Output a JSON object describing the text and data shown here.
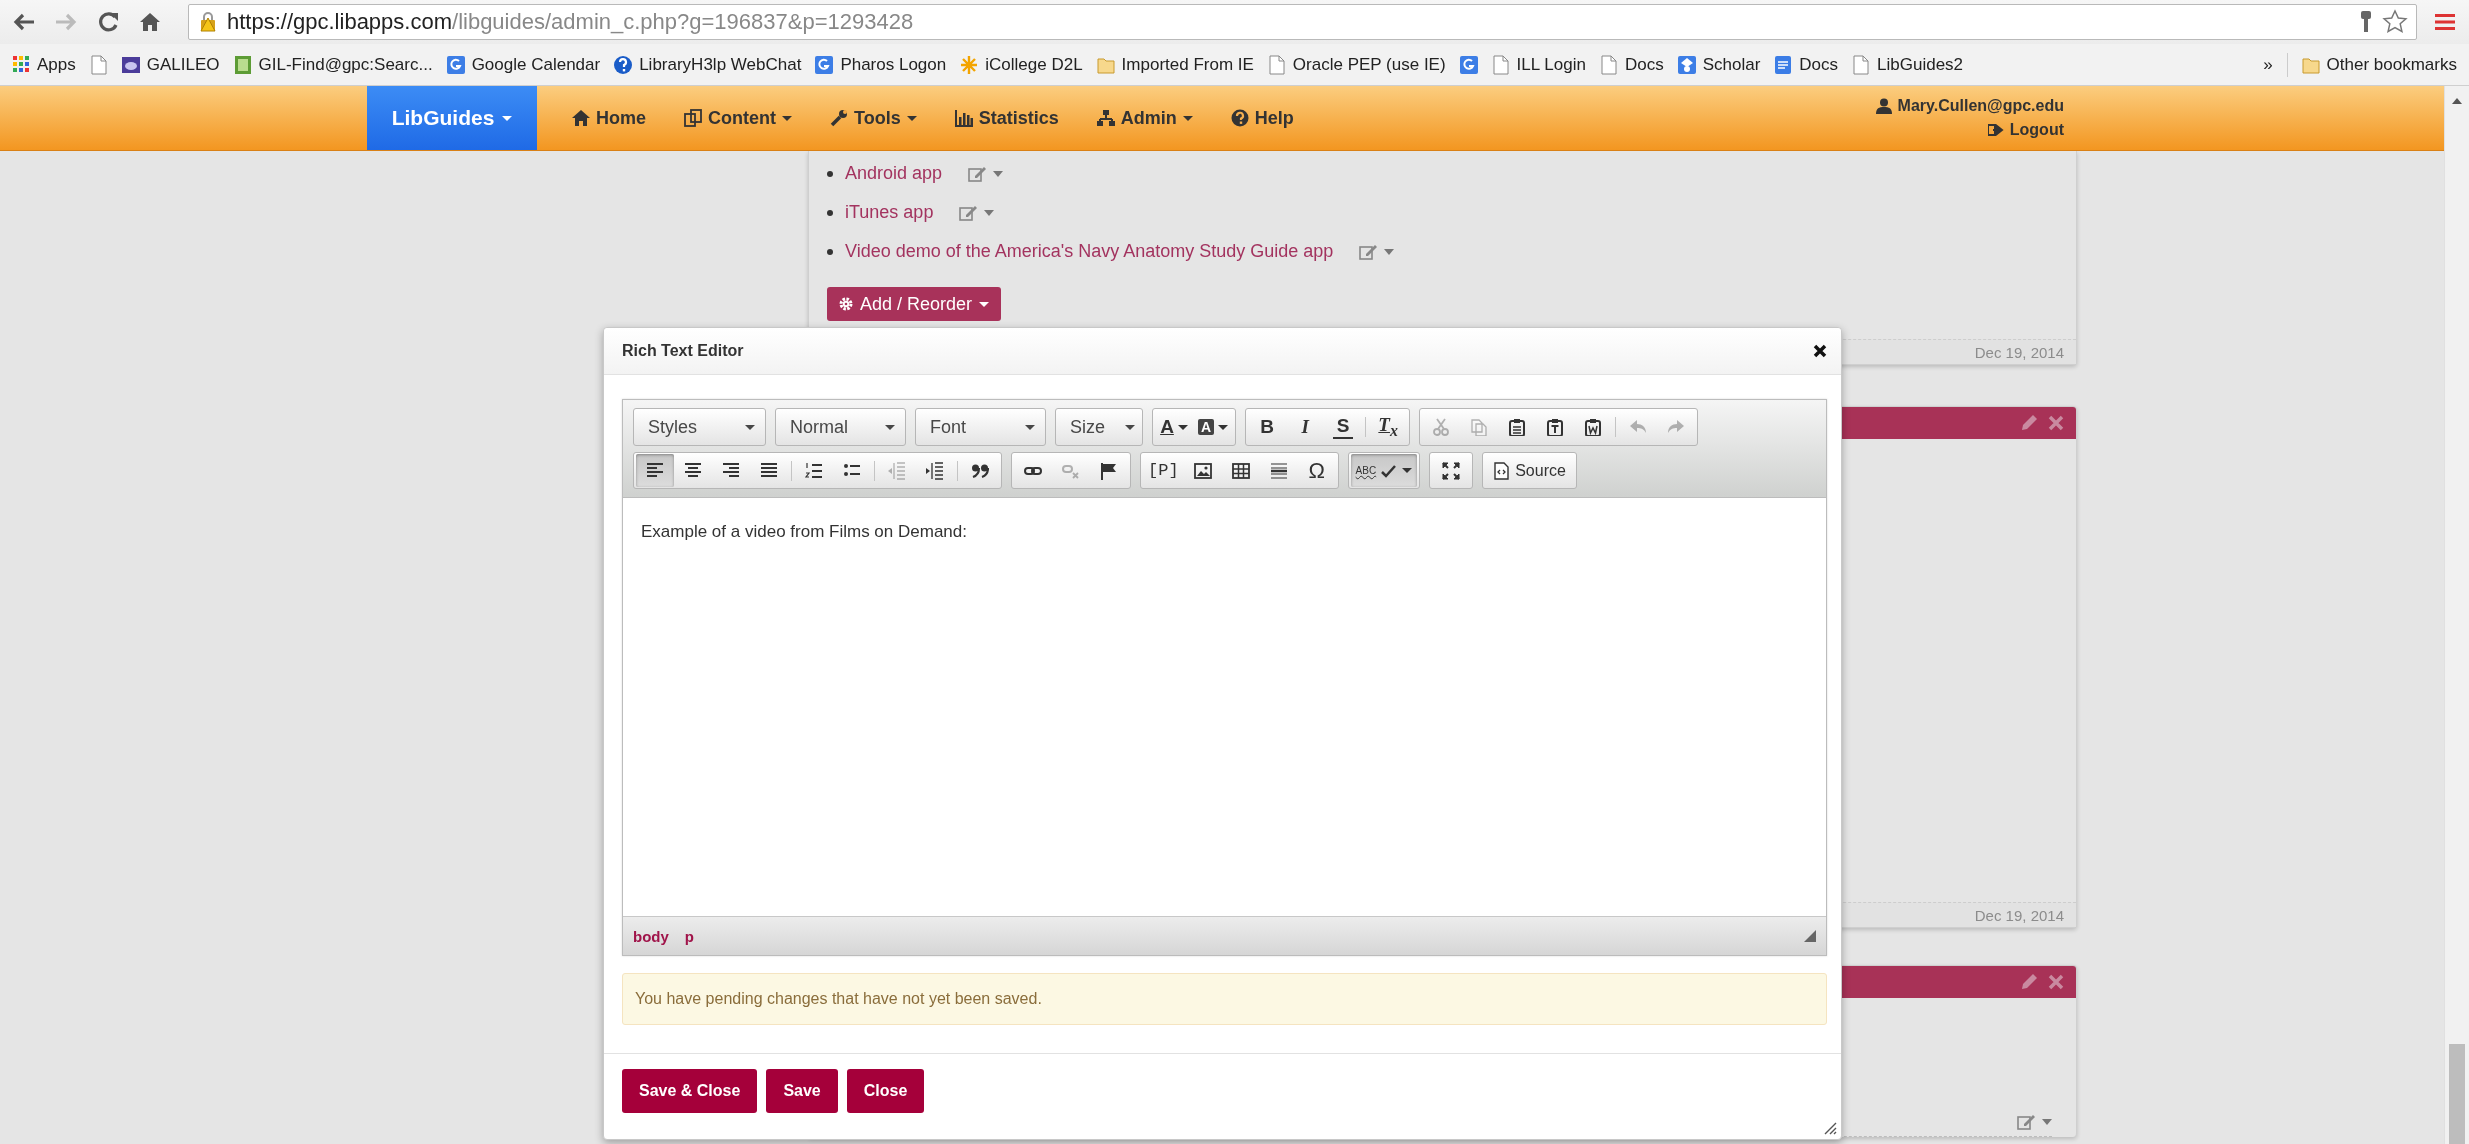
{
  "browser": {
    "url": {
      "host": "https://gpc.libapps.com",
      "path": "/libguides/admin_c.php?g=196837&p=1293428"
    }
  },
  "bookmarks": [
    {
      "kind": "apps",
      "label": "Apps"
    },
    {
      "kind": "page"
    },
    {
      "kind": "galileo",
      "label": "GALILEO"
    },
    {
      "kind": "gilfind",
      "label": "GIL-Find@gpc:Searc..."
    },
    {
      "kind": "google",
      "label": "Google Calendar"
    },
    {
      "kind": "help",
      "label": "LibraryH3lp WebChat"
    },
    {
      "kind": "google",
      "label": "Pharos Logon"
    },
    {
      "kind": "star",
      "label": "iCollege D2L"
    },
    {
      "kind": "folder",
      "label": "Imported From IE"
    },
    {
      "kind": "page",
      "label": "Oracle PEP (use IE)"
    },
    {
      "kind": "google"
    },
    {
      "kind": "page",
      "label": "ILL Login"
    },
    {
      "kind": "page",
      "label": "Docs"
    },
    {
      "kind": "scholar",
      "label": "Scholar"
    },
    {
      "kind": "docs",
      "label": "Docs"
    },
    {
      "kind": "page",
      "label": "LibGuides2"
    }
  ],
  "bookmarks_overflow": "»",
  "other_bookmarks": "Other bookmarks",
  "nav": {
    "brand": "LibGuides",
    "items": [
      {
        "kind": "home",
        "label": "Home",
        "caret": false
      },
      {
        "kind": "content",
        "label": "Content",
        "caret": true
      },
      {
        "kind": "tools",
        "label": "Tools",
        "caret": true
      },
      {
        "kind": "stats",
        "label": "Statistics",
        "caret": false
      },
      {
        "kind": "admin",
        "label": "Admin",
        "caret": true
      },
      {
        "kind": "help",
        "label": "Help",
        "caret": false
      }
    ],
    "user": "Mary.Cullen@gpc.edu",
    "logout": "Logout"
  },
  "page": {
    "links": [
      "Android app",
      "iTunes app",
      "Video demo of the America's Navy Anatomy Study Guide app"
    ],
    "add_button": "Add / Reorder",
    "panel_dates": [
      "Dec 19, 2014",
      "Dec 19, 2014"
    ]
  },
  "dialog": {
    "title": "Rich Text Editor",
    "toolbar": {
      "rows": [
        {
          "combos": [
            "Styles",
            "Normal",
            "Font",
            "Size"
          ],
          "groups": [
            {
              "buttons": [
                {
                  "kind": "textcolor",
                  "label": "A",
                  "disabled": false,
                  "selected": false
                },
                {
                  "kind": "bgcolor",
                  "label": "A",
                  "disabled": false,
                  "selected": false
                }
              ]
            },
            {
              "buttons": [
                {
                  "kind": "bold",
                  "label": "B",
                  "disabled": false,
                  "selected": false
                },
                {
                  "kind": "italic",
                  "label": "I",
                  "disabled": false,
                  "selected": false
                },
                {
                  "kind": "strike",
                  "label": "S",
                  "disabled": false,
                  "selected": false
                },
                {
                  "kind": "sep"
                },
                {
                  "kind": "removeformat",
                  "label": "T$_{x}$",
                  "disabled": false,
                  "selected": false
                }
              ]
            },
            {
              "buttons": [
                {
                  "kind": "cut",
                  "disabled": true,
                  "selected": false
                },
                {
                  "kind": "copy",
                  "disabled": true,
                  "selected": false
                },
                {
                  "kind": "paste",
                  "disabled": false,
                  "selected": false
                },
                {
                  "kind": "pastetext",
                  "disabled": false,
                  "selected": false
                },
                {
                  "kind": "pasteword",
                  "disabled": false,
                  "selected": false
                },
                {
                  "kind": "sep"
                },
                {
                  "kind": "undo",
                  "disabled": true,
                  "selected": false
                },
                {
                  "kind": "redo",
                  "disabled": true,
                  "selected": false
                }
              ]
            }
          ]
        },
        {
          "groups": [
            {
              "buttons": [
                {
                  "kind": "alignleft",
                  "disabled": false,
                  "selected": true
                },
                {
                  "kind": "aligncenter",
                  "disabled": false,
                  "selected": false
                },
                {
                  "kind": "alignright",
                  "disabled": false,
                  "selected": false
                },
                {
                  "kind": "justify",
                  "disabled": false,
                  "selected": false
                },
                {
                  "kind": "sep"
                },
                {
                  "kind": "numlist",
                  "disabled": false,
                  "selected": false
                },
                {
                  "kind": "bullist",
                  "disabled": false,
                  "selected": false
                },
                {
                  "kind": "sep"
                },
                {
                  "kind": "outdent",
                  "disabled": true,
                  "selected": false
                },
                {
                  "kind": "indent",
                  "disabled": false,
                  "selected": false
                },
                {
                  "kind": "sep"
                },
                {
                  "kind": "blockquote",
                  "disabled": false,
                  "selected": false
                }
              ]
            },
            {
              "buttons": [
                {
                  "kind": "link",
                  "disabled": false,
                  "selected": false
                },
                {
                  "kind": "unlink",
                  "disabled": true,
                  "selected": false
                },
                {
                  "kind": "anchor",
                  "disabled": false,
                  "selected": false
                }
              ]
            },
            {
              "buttons": [
                {
                  "kind": "placeholder",
                  "label": "[P]",
                  "disabled": false,
                  "selected": false
                },
                {
                  "kind": "image",
                  "disabled": false,
                  "selected": false
                },
                {
                  "kind": "table",
                  "disabled": false,
                  "selected": false
                },
                {
                  "kind": "hr",
                  "disabled": false,
                  "selected": false
                },
                {
                  "kind": "specialchar",
                  "label": "Ω",
                  "disabled": false,
                  "selected": false
                }
              ]
            },
            {
              "buttons": [
                {
                  "kind": "spell",
                  "label": "ABC",
                  "disabled": false,
                  "selected": true
                }
              ]
            },
            {
              "buttons": [
                {
                  "kind": "maximize",
                  "disabled": false,
                  "selected": false
                }
              ]
            },
            {
              "buttons": [
                {
                  "kind": "source",
                  "label": "Source",
                  "disabled": false,
                  "selected": false
                }
              ]
            }
          ]
        }
      ]
    },
    "content": "Example of a video from Films on Demand:",
    "path": [
      "body",
      "p"
    ],
    "alert": "You have pending changes that have not yet been saved.",
    "buttons": [
      "Save & Close",
      "Save",
      "Close"
    ]
  }
}
